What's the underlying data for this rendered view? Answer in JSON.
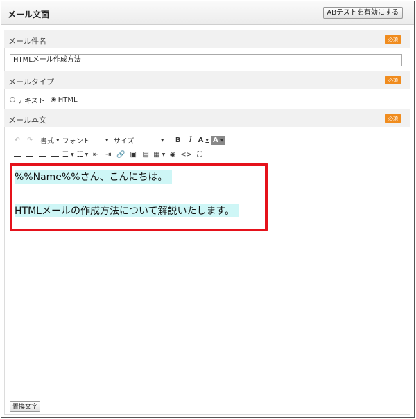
{
  "header": {
    "title": "メール文面",
    "ab_button": "ABテストを有効にする"
  },
  "badge_label": "必須",
  "subject": {
    "label": "メール件名",
    "value": "HTMLメール作成方法"
  },
  "mail_type": {
    "label": "メールタイプ",
    "options": [
      "テキスト",
      "HTML"
    ],
    "selected": "HTML"
  },
  "body": {
    "label": "メール本文",
    "toolbar": {
      "format": "書式",
      "font": "フォント",
      "size": "サイズ",
      "bold": "B",
      "italic": "I",
      "text_color": "A",
      "bg_color": "A",
      "source": "<>"
    },
    "lines": [
      "%%Name%%さん、こんにちは。",
      "HTMLメールの作成方法について解説いたします。"
    ]
  },
  "replace_button": "置換文字",
  "colors": {
    "required_badge": "#f08c1e",
    "highlight_border": "#e5121b",
    "text_highlight": "#cef6f6"
  },
  "icons": [
    "undo-icon",
    "redo-icon",
    "align-left-icon",
    "align-center-icon",
    "align-right-icon",
    "align-justify-icon",
    "bulleted-list-icon",
    "numbered-list-icon",
    "outdent-icon",
    "indent-icon",
    "link-icon",
    "image-icon",
    "video-icon",
    "table-icon",
    "preview-icon",
    "source-code-icon",
    "fullscreen-icon"
  ]
}
